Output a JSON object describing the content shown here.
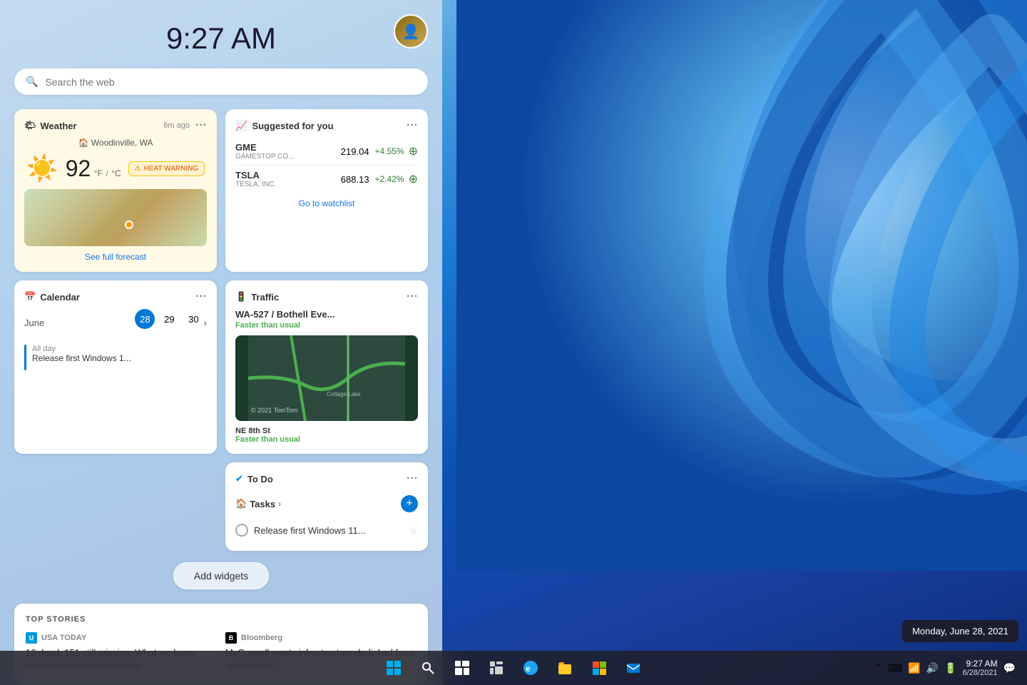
{
  "time": "9:27 AM",
  "search": {
    "placeholder": "Search the web"
  },
  "weather": {
    "title": "Weather",
    "updated": "6m ago",
    "location": "Woodinville, WA",
    "temperature": "92",
    "unit_f": "°F",
    "unit_c": "°C",
    "warning": "HEAT WARNING",
    "forecast_link": "See full forecast"
  },
  "stocks": {
    "title": "Suggested for you",
    "items": [
      {
        "symbol": "GME",
        "name": "GAMESTOP CO...",
        "price": "219.04",
        "change": "+4.55%",
        "positive": true
      },
      {
        "symbol": "TSLA",
        "name": "TESLA, INC.",
        "price": "688.13",
        "change": "+2.42%",
        "positive": true
      }
    ],
    "watchlist_link": "Go to watchlist"
  },
  "traffic": {
    "title": "Traffic",
    "route": "WA-527 / Bothell Eve...",
    "status1": "Faster than usual",
    "street": "NE 8th St",
    "status2": "Faster than usual",
    "location_label": "Cottage Lake",
    "copyright": "© 2021 TomTom"
  },
  "calendar": {
    "title": "Calendar",
    "month": "June",
    "days": [
      {
        "num": "28",
        "today": true
      },
      {
        "num": "29",
        "today": false
      },
      {
        "num": "30",
        "today": false
      }
    ],
    "event_time": "All day",
    "event_title": "Release first Windows 1..."
  },
  "todo": {
    "title": "To Do",
    "list_label": "Tasks",
    "items": [
      {
        "text": "Release first Windows 11...",
        "starred": false
      }
    ]
  },
  "add_widgets": "Add widgets",
  "top_stories": {
    "title": "TOP STORIES",
    "items": [
      {
        "source": "USA TODAY",
        "source_color": "#009bde",
        "headline": "10 dead, 151 still missing: What we know about Miami condo collapse"
      },
      {
        "source": "Bloomberg",
        "source_color": "#000000",
        "headline": "McConnell wants infrastructure de-linked from spending bill"
      }
    ]
  },
  "taskbar": {
    "start_label": "Start",
    "search_label": "Search",
    "task_view_label": "Task View",
    "widgets_label": "Widgets",
    "edge_label": "Microsoft Edge",
    "file_explorer_label": "File Explorer",
    "microsoft_store_label": "Microsoft Store",
    "mail_label": "Mail"
  },
  "system_tray": {
    "time": "9:27 AM",
    "date": "6/28/2021",
    "date_tooltip": "Monday, June 28, 2021"
  }
}
